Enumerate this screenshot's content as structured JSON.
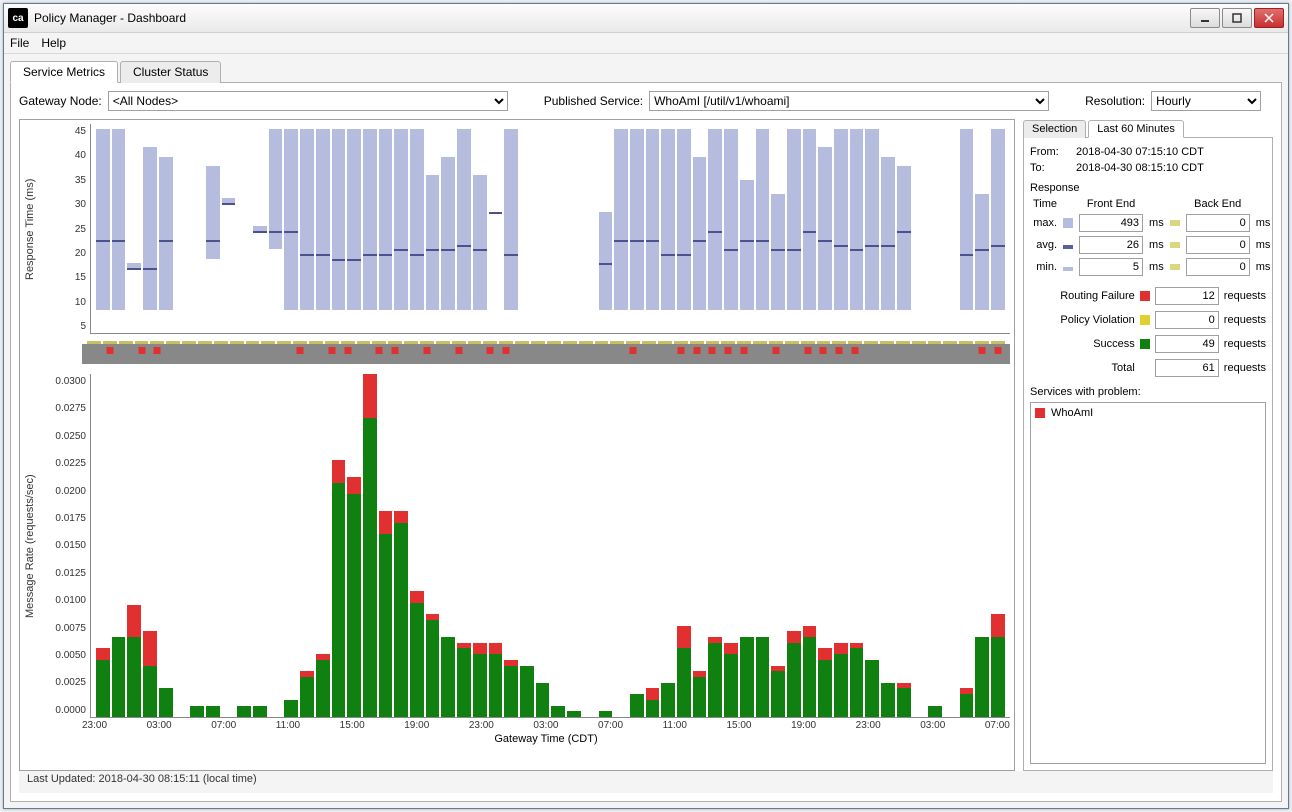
{
  "window": {
    "title": "Policy Manager - Dashboard",
    "logo": "ca"
  },
  "menus": {
    "file": "File",
    "help": "Help"
  },
  "tabs": {
    "metrics": "Service Metrics",
    "cluster": "Cluster Status"
  },
  "filters": {
    "gateway_label": "Gateway Node:",
    "gateway_value": "<All Nodes>",
    "service_label": "Published Service:",
    "service_value": "WhoAmI [/util/v1/whoami]",
    "resolution_label": "Resolution:",
    "resolution_value": "Hourly"
  },
  "sidebar": {
    "tab_selection": "Selection",
    "tab_last60": "Last 60 Minutes",
    "from_label": "From:",
    "from_value": "2018-04-30 07:15:10 CDT",
    "to_label": "To:",
    "to_value": "2018-04-30 08:15:10 CDT",
    "section_response": "Response",
    "col_time": "Time",
    "col_frontend": "Front End",
    "col_backend": "Back End",
    "row_max": "max.",
    "row_avg": "avg.",
    "row_min": "min.",
    "unit_ms": "ms",
    "fe_max": "493",
    "fe_avg": "26",
    "fe_min": "5",
    "be_max": "0",
    "be_avg": "0",
    "be_min": "0",
    "routing_failure": "Routing Failure",
    "routing_failure_val": "12",
    "policy_violation": "Policy Violation",
    "policy_violation_val": "0",
    "success": "Success",
    "success_val": "49",
    "total": "Total",
    "total_val": "61",
    "requests_unit": "requests",
    "problem_label": "Services with problem:",
    "problem_service": "WhoAmI"
  },
  "status": "Last Updated: 2018-04-30 08:15:11 (local time)",
  "chart_data": [
    {
      "type": "area",
      "title": "Response Time",
      "ylabel": "Response Time (ms)",
      "ylim": [
        0,
        45
      ],
      "yticks": [
        45,
        40,
        35,
        30,
        25,
        20,
        15,
        10,
        5
      ],
      "xlabel": "Gateway Time (CDT)",
      "xticks": [
        "23:00",
        "03:00",
        "07:00",
        "11:00",
        "15:00",
        "19:00",
        "23:00",
        "03:00",
        "07:00",
        "11:00",
        "15:00",
        "19:00",
        "23:00",
        "03:00",
        "07:00"
      ],
      "series_note": "min/max range with avg line, values ≈ from pixels",
      "buckets": [
        {
          "min": 5,
          "avg": 20,
          "max": 44
        },
        {
          "min": 5,
          "avg": 20,
          "max": 44
        },
        {
          "min": 14,
          "avg": 14,
          "max": 15
        },
        {
          "min": 5,
          "avg": 14,
          "max": 40
        },
        {
          "min": 5,
          "avg": 20,
          "max": 38
        },
        {
          "min": null,
          "avg": null,
          "max": null
        },
        {
          "min": null,
          "avg": null,
          "max": null
        },
        {
          "min": 16,
          "avg": 20,
          "max": 36
        },
        {
          "min": 28,
          "avg": 28,
          "max": 29
        },
        {
          "min": null,
          "avg": null,
          "max": null
        },
        {
          "min": 22,
          "avg": 22,
          "max": 23
        },
        {
          "min": 18,
          "avg": 22,
          "max": 44
        },
        {
          "min": 5,
          "avg": 22,
          "max": 44
        },
        {
          "min": 5,
          "avg": 17,
          "max": 44
        },
        {
          "min": 5,
          "avg": 17,
          "max": 44
        },
        {
          "min": 5,
          "avg": 16,
          "max": 44
        },
        {
          "min": 5,
          "avg": 16,
          "max": 44
        },
        {
          "min": 5,
          "avg": 17,
          "max": 44
        },
        {
          "min": 5,
          "avg": 17,
          "max": 44
        },
        {
          "min": 5,
          "avg": 18,
          "max": 44
        },
        {
          "min": 5,
          "avg": 17,
          "max": 44
        },
        {
          "min": 5,
          "avg": 18,
          "max": 34
        },
        {
          "min": 5,
          "avg": 18,
          "max": 38
        },
        {
          "min": 5,
          "avg": 19,
          "max": 44
        },
        {
          "min": 5,
          "avg": 18,
          "max": 34
        },
        {
          "min": null,
          "avg": 26,
          "max": null
        },
        {
          "min": 5,
          "avg": 17,
          "max": 44
        },
        {
          "min": null,
          "avg": null,
          "max": null
        },
        {
          "min": null,
          "avg": null,
          "max": null
        },
        {
          "min": null,
          "avg": null,
          "max": null
        },
        {
          "min": null,
          "avg": null,
          "max": null
        },
        {
          "min": null,
          "avg": null,
          "max": null
        },
        {
          "min": 5,
          "avg": 15,
          "max": 26
        },
        {
          "min": 5,
          "avg": 20,
          "max": 44
        },
        {
          "min": 5,
          "avg": 20,
          "max": 44
        },
        {
          "min": 5,
          "avg": 20,
          "max": 44
        },
        {
          "min": 5,
          "avg": 17,
          "max": 44
        },
        {
          "min": 5,
          "avg": 17,
          "max": 44
        },
        {
          "min": 5,
          "avg": 20,
          "max": 38
        },
        {
          "min": 5,
          "avg": 22,
          "max": 44
        },
        {
          "min": 5,
          "avg": 18,
          "max": 44
        },
        {
          "min": 5,
          "avg": 20,
          "max": 33
        },
        {
          "min": 5,
          "avg": 20,
          "max": 44
        },
        {
          "min": 5,
          "avg": 18,
          "max": 30
        },
        {
          "min": 5,
          "avg": 18,
          "max": 44
        },
        {
          "min": 5,
          "avg": 22,
          "max": 44
        },
        {
          "min": 5,
          "avg": 20,
          "max": 40
        },
        {
          "min": 5,
          "avg": 19,
          "max": 44
        },
        {
          "min": 5,
          "avg": 18,
          "max": 44
        },
        {
          "min": 5,
          "avg": 19,
          "max": 44
        },
        {
          "min": 5,
          "avg": 19,
          "max": 38
        },
        {
          "min": 5,
          "avg": 22,
          "max": 36
        },
        {
          "min": null,
          "avg": null,
          "max": null
        },
        {
          "min": null,
          "avg": null,
          "max": null
        },
        {
          "min": null,
          "avg": null,
          "max": null
        },
        {
          "min": 5,
          "avg": 17,
          "max": 44
        },
        {
          "min": 5,
          "avg": 18,
          "max": 30
        },
        {
          "min": 5,
          "avg": 19,
          "max": 44
        }
      ]
    },
    {
      "type": "scatter",
      "title": "Failure markers",
      "note": "red squares = routing failure occurred in bucket",
      "failures_at": [
        1,
        3,
        4,
        13,
        15,
        16,
        18,
        19,
        21,
        23,
        25,
        26,
        34,
        37,
        38,
        39,
        40,
        41,
        43,
        45,
        46,
        47,
        48,
        56,
        57
      ]
    },
    {
      "type": "bar",
      "title": "Message Rate",
      "ylabel": "Message Rate (requests/sec)",
      "ylim": [
        0.0,
        0.03
      ],
      "yticks": [
        "0.0300",
        "0.0275",
        "0.0250",
        "0.0225",
        "0.0200",
        "0.0175",
        "0.0150",
        "0.0125",
        "0.0100",
        "0.0075",
        "0.0050",
        "0.0025",
        "0.0000"
      ],
      "xlabel": "Gateway Time (CDT)",
      "series": [
        {
          "name": "Success",
          "color": "#108010"
        },
        {
          "name": "Routing Failure",
          "color": "#e03030"
        }
      ],
      "buckets": [
        {
          "s": 0.005,
          "f": 0.001
        },
        {
          "s": 0.007,
          "f": 0.0
        },
        {
          "s": 0.007,
          "f": 0.0028
        },
        {
          "s": 0.0045,
          "f": 0.003
        },
        {
          "s": 0.0025,
          "f": 0.0
        },
        {
          "s": 0.0,
          "f": 0.0
        },
        {
          "s": 0.001,
          "f": 0.0
        },
        {
          "s": 0.001,
          "f": 0.0
        },
        {
          "s": 0.0,
          "f": 0.0
        },
        {
          "s": 0.001,
          "f": 0.0
        },
        {
          "s": 0.001,
          "f": 0.0
        },
        {
          "s": 0.0,
          "f": 0.0
        },
        {
          "s": 0.0015,
          "f": 0.0
        },
        {
          "s": 0.0035,
          "f": 0.0005
        },
        {
          "s": 0.005,
          "f": 0.0005
        },
        {
          "s": 0.0205,
          "f": 0.002
        },
        {
          "s": 0.0195,
          "f": 0.0015
        },
        {
          "s": 0.0275,
          "f": 0.004
        },
        {
          "s": 0.016,
          "f": 0.002
        },
        {
          "s": 0.017,
          "f": 0.001
        },
        {
          "s": 0.01,
          "f": 0.001
        },
        {
          "s": 0.0085,
          "f": 0.0005
        },
        {
          "s": 0.007,
          "f": 0.0
        },
        {
          "s": 0.006,
          "f": 0.0005
        },
        {
          "s": 0.0055,
          "f": 0.001
        },
        {
          "s": 0.0055,
          "f": 0.001
        },
        {
          "s": 0.0045,
          "f": 0.0005
        },
        {
          "s": 0.0045,
          "f": 0.0
        },
        {
          "s": 0.003,
          "f": 0.0
        },
        {
          "s": 0.001,
          "f": 0.0
        },
        {
          "s": 0.0005,
          "f": 0.0
        },
        {
          "s": 0.0,
          "f": 0.0
        },
        {
          "s": 0.0005,
          "f": 0.0
        },
        {
          "s": 0.0,
          "f": 0.0
        },
        {
          "s": 0.002,
          "f": 0.0
        },
        {
          "s": 0.0015,
          "f": 0.001
        },
        {
          "s": 0.003,
          "f": 0.0
        },
        {
          "s": 0.006,
          "f": 0.002
        },
        {
          "s": 0.0035,
          "f": 0.0005
        },
        {
          "s": 0.0065,
          "f": 0.0005
        },
        {
          "s": 0.0055,
          "f": 0.001
        },
        {
          "s": 0.007,
          "f": 0.0
        },
        {
          "s": 0.007,
          "f": 0.0
        },
        {
          "s": 0.004,
          "f": 0.0005
        },
        {
          "s": 0.0065,
          "f": 0.001
        },
        {
          "s": 0.007,
          "f": 0.001
        },
        {
          "s": 0.005,
          "f": 0.001
        },
        {
          "s": 0.0055,
          "f": 0.001
        },
        {
          "s": 0.006,
          "f": 0.0005
        },
        {
          "s": 0.005,
          "f": 0.0
        },
        {
          "s": 0.003,
          "f": 0.0
        },
        {
          "s": 0.0025,
          "f": 0.0005
        },
        {
          "s": 0.0,
          "f": 0.0
        },
        {
          "s": 0.001,
          "f": 0.0
        },
        {
          "s": 0.0,
          "f": 0.0
        },
        {
          "s": 0.002,
          "f": 0.0005
        },
        {
          "s": 0.007,
          "f": 0.0
        },
        {
          "s": 0.007,
          "f": 0.002
        }
      ]
    }
  ]
}
